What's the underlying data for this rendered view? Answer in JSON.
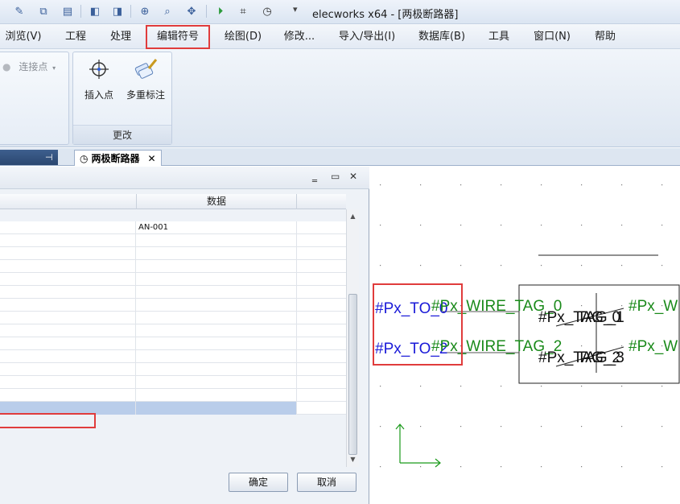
{
  "window": {
    "title": "elecworks x64 - [两极断路器]"
  },
  "quick_access": [
    {
      "icon": "brush-icon"
    },
    {
      "icon": "copy-icon"
    },
    {
      "icon": "paste-icon"
    },
    {
      "icon": "page-back-icon"
    },
    {
      "icon": "page-forward-icon"
    },
    {
      "icon": "zoom-fit-icon"
    },
    {
      "icon": "zoom-icon"
    },
    {
      "icon": "pan-icon"
    },
    {
      "icon": "play-icon"
    },
    {
      "icon": "binoculars-icon"
    },
    {
      "icon": "timer-icon"
    }
  ],
  "menu": [
    {
      "label": "浏览(V)"
    },
    {
      "label": "工程"
    },
    {
      "label": "处理"
    },
    {
      "label": "编辑符号"
    },
    {
      "label": "绘图(D)"
    },
    {
      "label": "修改..."
    },
    {
      "label": "导入/导出(I)"
    },
    {
      "label": "数据库(B)"
    },
    {
      "label": "工具"
    },
    {
      "label": "窗口(N)"
    },
    {
      "label": "帮助"
    }
  ],
  "ribbon": {
    "connection_point": "连接点",
    "insert_point": "插入点",
    "multi_annotation": "多重标注",
    "group_label": "更改"
  },
  "tabs": {
    "document": "两极断路器"
  },
  "dialog": {
    "column_header": "数据",
    "rows": [
      "AN-001",
      "",
      "",
      "",
      "",
      "",
      "",
      "",
      "",
      "",
      "",
      "",
      "",
      "",
      ""
    ],
    "ok": "确定",
    "cancel": "取消"
  },
  "drawing": {
    "labels": {
      "to0": "#Px_TO_0",
      "to2": "#Px_TO_2",
      "wire0": "#Px_WIRE_TAG_0",
      "wire2": "#Px_WIRE_TAG_2",
      "wire_right": "#Px_W",
      "tag0a": "#Px_TAG_0",
      "tag1": "TAG_1",
      "tag2a": "#Px_TAG_2",
      "tag3": "TAG_3"
    },
    "colors": {
      "blue": "#1a1ad8",
      "green": "#1a8a1a",
      "highlight": "#e03c3c"
    }
  }
}
